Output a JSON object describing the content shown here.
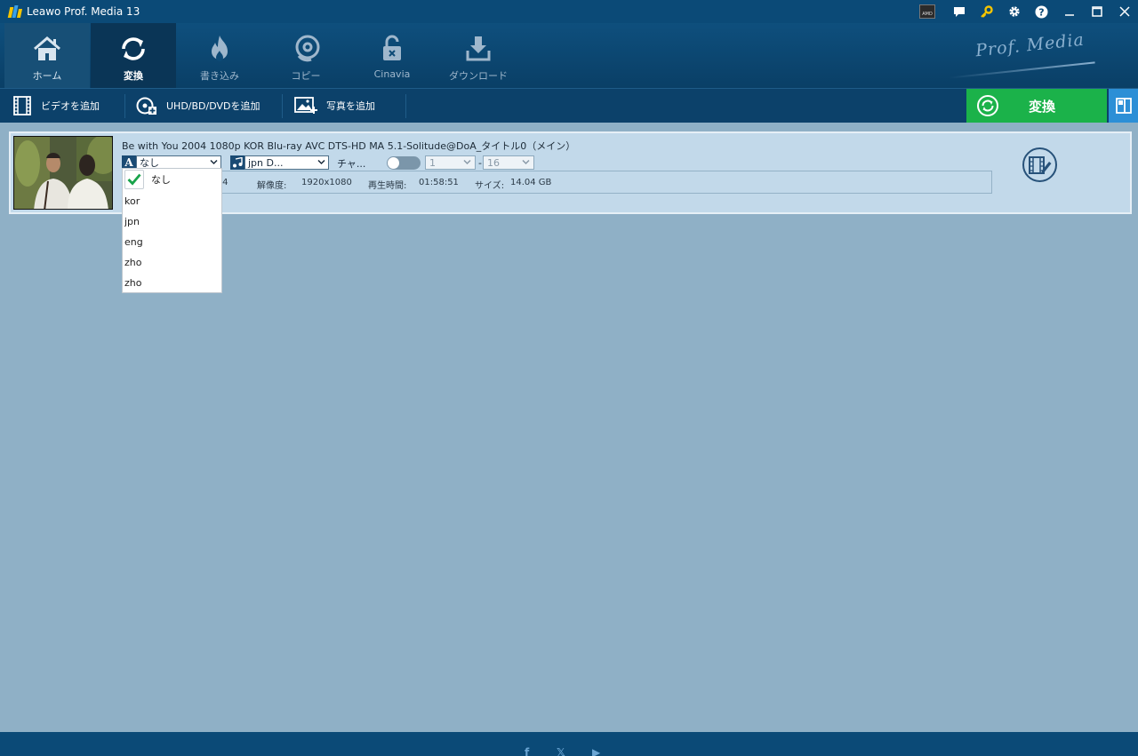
{
  "window": {
    "title": "Leawo Prof. Media 13",
    "icons": [
      "amd-icon",
      "chat-icon",
      "key-icon",
      "gear-icon",
      "help-icon",
      "minimize-icon",
      "maximize-icon",
      "close-icon"
    ],
    "amd_label": "AMD"
  },
  "nav": {
    "tabs": [
      {
        "label": "ホーム",
        "icon": "home-icon"
      },
      {
        "label": "変換",
        "icon": "convert-icon"
      },
      {
        "label": "書き込み",
        "icon": "burn-icon"
      },
      {
        "label": "コピー",
        "icon": "copy-icon"
      },
      {
        "label": "Cinavia",
        "icon": "cinavia-icon"
      },
      {
        "label": "ダウンロード",
        "icon": "download-icon"
      }
    ],
    "active_index": 1,
    "brand": "Prof. Media"
  },
  "toolbar": {
    "add_video": "ビデオを追加",
    "add_disc": "UHD/BD/DVDを追加",
    "add_photo": "写真を追加",
    "convert_label": "変換",
    "accent_color": "#1bb24a"
  },
  "file": {
    "title": "Be with You 2004 1080p KOR Blu-ray AVC DTS-HD MA 5.1-Solitude@DoA_タイトル0（メイン）",
    "subtitle_value": "なし",
    "audio_value": "jpn D...",
    "chapter_label": "チャ...",
    "range_start": "1",
    "range_separator": "-",
    "range_end": "16",
    "format_value": "mp4",
    "resolution_label": "解像度:",
    "resolution_value": "1920x1080",
    "duration_label": "再生時間:",
    "duration_value": "01:58:51",
    "size_label": "サイズ:",
    "size_value": "14.04 GB"
  },
  "subtitle_dropdown": {
    "items": [
      "なし",
      "kor",
      "jpn",
      "eng",
      "zho",
      "zho"
    ],
    "selected_index": 0
  },
  "footer": {
    "social": [
      "f",
      "𝕏",
      "▶"
    ]
  }
}
